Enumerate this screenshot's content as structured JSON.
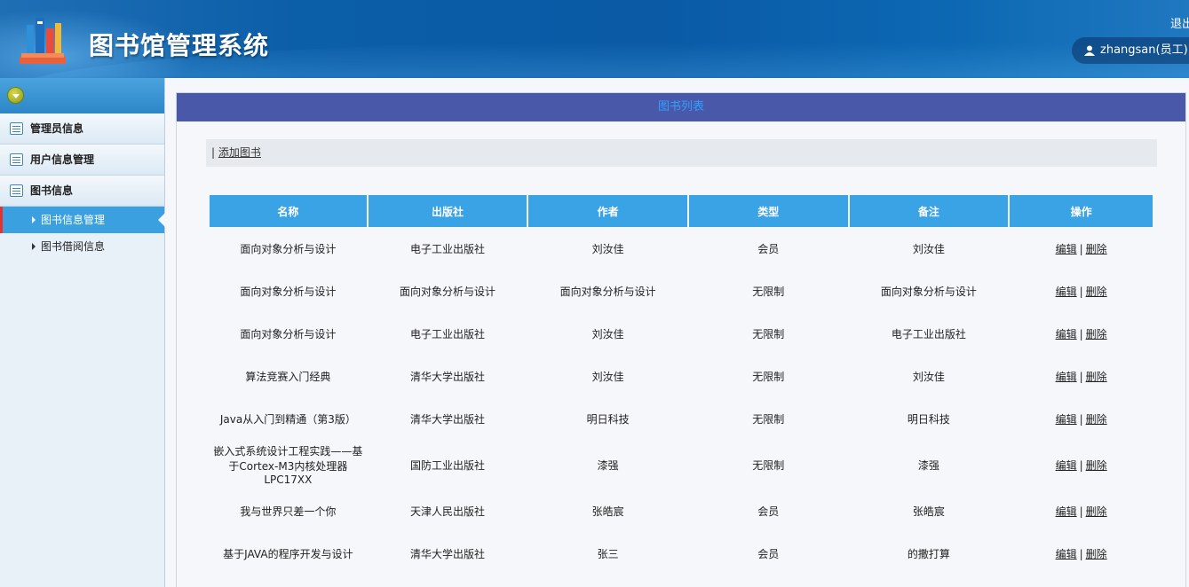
{
  "header": {
    "title": "图书馆管理系统",
    "logout_label": "退出",
    "user_label": "zhangsan(员工)"
  },
  "sidebar": {
    "groups": [
      {
        "label": "管理员信息"
      },
      {
        "label": "用户信息管理"
      },
      {
        "label": "图书信息"
      }
    ],
    "sub_items": [
      {
        "label": "图书信息管理",
        "active": true
      },
      {
        "label": "图书借阅信息",
        "active": false
      }
    ]
  },
  "main": {
    "panel_title": "图书列表",
    "toolbar": {
      "separator": "|",
      "add_label": "添加图书"
    },
    "table": {
      "headers": [
        "名称",
        "出版社",
        "作者",
        "类型",
        "备注",
        "操作"
      ],
      "edit_label": "编辑",
      "delete_label": "删除",
      "action_separator": "|",
      "rows": [
        [
          "面向对象分析与设计",
          "电子工业出版社",
          "刘汝佳",
          "会员",
          "刘汝佳"
        ],
        [
          "面向对象分析与设计",
          "面向对象分析与设计",
          "面向对象分析与设计",
          "无限制",
          "面向对象分析与设计"
        ],
        [
          "面向对象分析与设计",
          "电子工业出版社",
          "刘汝佳",
          "无限制",
          "电子工业出版社"
        ],
        [
          "算法竞赛入门经典",
          "清华大学出版社",
          "刘汝佳",
          "无限制",
          "刘汝佳"
        ],
        [
          "Java从入门到精通（第3版）",
          "清华大学出版社",
          "明日科技",
          "无限制",
          "明日科技"
        ],
        [
          "嵌入式系统设计工程实践——基于Cortex-M3内核处理器LPC17XX",
          "国防工业出版社",
          "漆强",
          "无限制",
          "漆强"
        ],
        [
          "我与世界只差一个你",
          "天津人民出版社",
          "张皓宸",
          "会员",
          "张皓宸"
        ],
        [
          "基于JAVA的程序开发与设计",
          "清华大学出版社",
          "张三",
          "会员",
          "的撒打算"
        ]
      ]
    }
  }
}
